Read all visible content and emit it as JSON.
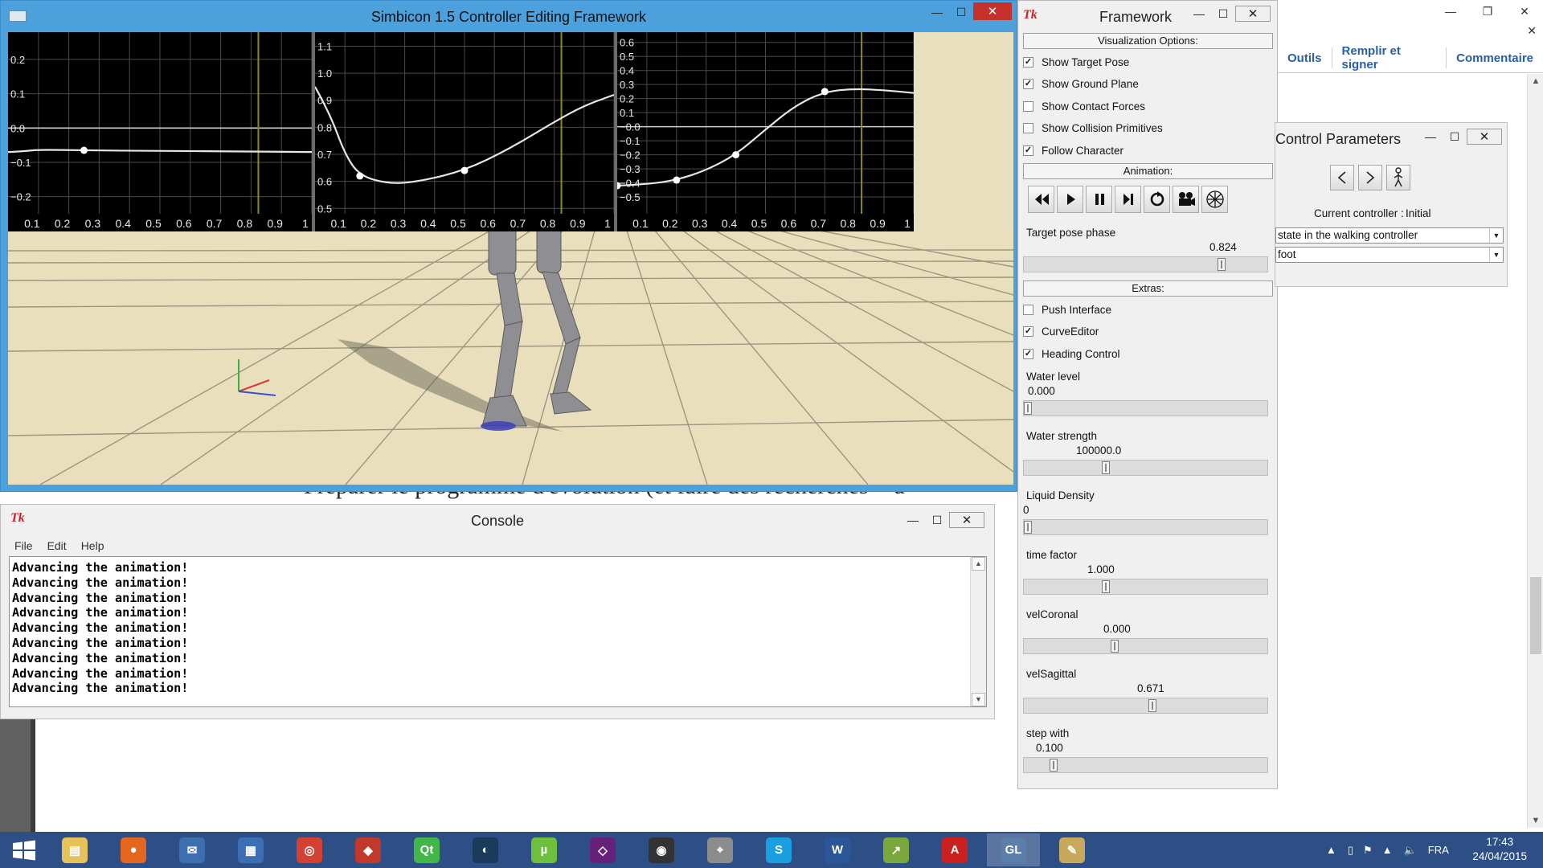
{
  "document": {
    "toolbar": [
      "Outils",
      "Remplir et signer",
      "Commentaire"
    ],
    "body_text": "Préparer le programme d'évolution (et faire des recherches  + a"
  },
  "simbicon": {
    "title": "Simbicon 1.5 Controller Editing Framework",
    "graphs": [
      {
        "y_ticks": [
          "0.2",
          "0.1",
          "0.0",
          "−0.1",
          "−0.2"
        ],
        "x_ticks": [
          "0.1",
          "0.2",
          "0.3",
          "0.4",
          "0.5",
          "0.6",
          "0.7",
          "0.8",
          "0.9",
          "1"
        ]
      },
      {
        "y_ticks": [
          "1.1",
          "1.0",
          "0.9",
          "0.8",
          "0.7",
          "0.6",
          "0.5"
        ],
        "x_ticks": [
          "0.1",
          "0.2",
          "0.3",
          "0.4",
          "0.5",
          "0.6",
          "0.7",
          "0.8",
          "0.9",
          "1"
        ]
      },
      {
        "y_ticks": [
          "0.6",
          "0.5",
          "0.4",
          "0.3",
          "0.2",
          "0.1",
          "−0.0",
          "−0.1",
          "−0.2",
          "−0.3",
          "−0.4",
          "−0.5"
        ],
        "x_ticks": [
          "0.1",
          "0.2",
          "0.3",
          "0.4",
          "0.5",
          "0.6",
          "0.7",
          "0.8",
          "0.9",
          "1"
        ]
      }
    ]
  },
  "console": {
    "title": "Console",
    "icon": "Tk",
    "menu": [
      "File",
      "Edit",
      "Help"
    ],
    "lines": [
      "Advancing the animation!",
      "Advancing the animation!",
      "Advancing the animation!",
      "Advancing the animation!",
      "Advancing the animation!",
      "Advancing the animation!",
      "Advancing the animation!",
      "Advancing the animation!",
      "Advancing the animation!"
    ]
  },
  "framework": {
    "title": "Framework",
    "icon": "Tk",
    "visualization_header": "Visualization Options:",
    "visualization": [
      {
        "label": "Show Target Pose",
        "checked": true
      },
      {
        "label": "Show Ground Plane",
        "checked": true
      },
      {
        "label": "Show Contact Forces",
        "checked": false
      },
      {
        "label": "Show Collision Primitives",
        "checked": false
      },
      {
        "label": "Follow Character",
        "checked": true
      }
    ],
    "animation_header": "Animation:",
    "animation_buttons": [
      "rewind-icon",
      "play-icon",
      "pause-icon",
      "step-icon",
      "restart-icon",
      "camera-icon",
      "mesh-icon"
    ],
    "extras_header": "Extras:",
    "extras": [
      {
        "label": "Push Interface",
        "checked": false
      },
      {
        "label": "CurveEditor",
        "checked": true
      },
      {
        "label": "Heading Control",
        "checked": true
      }
    ],
    "target_pose_phase": {
      "label": "Target pose phase",
      "value": "0.824",
      "fraction": 0.824
    },
    "sliders": [
      {
        "label": "Water level",
        "value": "0.000",
        "fraction": 0.0
      },
      {
        "label": "Water strength",
        "value": "100000.0",
        "fraction": 0.33
      },
      {
        "label": "Liquid Density",
        "value": "0",
        "fraction": 0.0
      },
      {
        "label": "time factor",
        "value": "1.000",
        "fraction": 0.33
      },
      {
        "label": "velCoronal",
        "value": "0.000",
        "fraction": 0.37
      },
      {
        "label": "velSagittal",
        "value": "0.671",
        "fraction": 0.53
      },
      {
        "label": "step with",
        "value": "0.100",
        "fraction": 0.11
      }
    ]
  },
  "control_parameters": {
    "title": "Control Parameters",
    "current_controller_label": "Current controller :",
    "current_controller_value": "Initial",
    "state_select": "state in the walking controller",
    "second_select": "foot"
  },
  "taskbar": {
    "apps": [
      "file-explorer",
      "firefox",
      "thunderbird",
      "control-panel",
      "chrome",
      "app-red",
      "qt-creator",
      "steam",
      "utorrent",
      "visual-studio",
      "github",
      "joystick",
      "skype",
      "word",
      "excel-chart",
      "acrobat",
      "opengl",
      "paint"
    ],
    "language": "FRA",
    "time": "17:43",
    "date": "24/04/2015"
  }
}
